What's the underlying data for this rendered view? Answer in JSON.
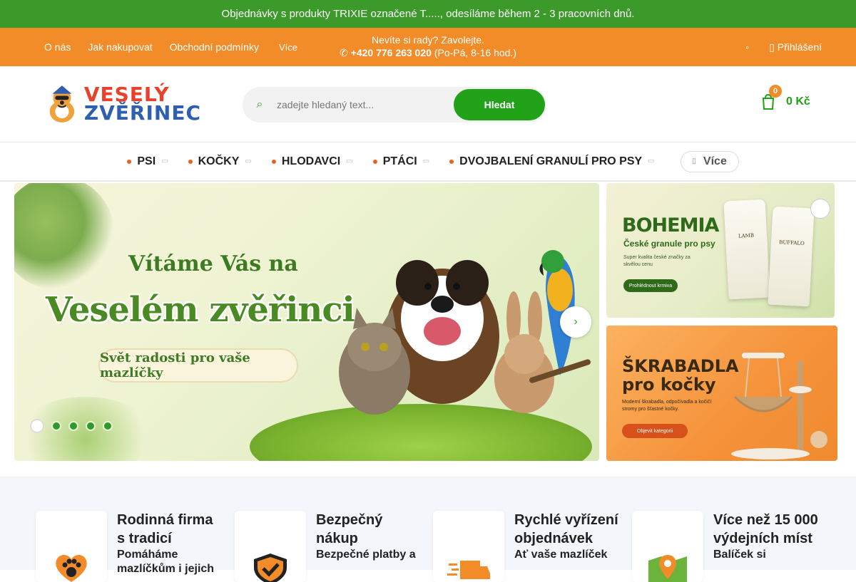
{
  "promo": {
    "text": "Objednávky s produkty TRIXIE označené T....., odesíláme během 2 - 3 pracovních dnů."
  },
  "topbar": {
    "links": [
      "O nás",
      "Jak nakupovat",
      "Obchodní podmínky"
    ],
    "more_label": "Více",
    "contact_line1": "Nevíte si rady? Zavolejte.",
    "phone": "+420 776 263 020",
    "hours": "(Po-Pá, 8-16 hod.)",
    "login_label": "Přihlášení"
  },
  "header": {
    "logo_line1": "VESELÝ",
    "logo_line2": "ZVĚŘINEC",
    "search_placeholder": "zadejte hledaný text...",
    "search_button": "Hledat",
    "cart_count": "0",
    "cart_total": "0 Kč"
  },
  "nav": {
    "items": [
      "PSI",
      "KOČKY",
      "HLODAVCI",
      "PTÁCI",
      "DVOJBALENÍ GRANULÍ PRO PSY"
    ],
    "more_label": "Více"
  },
  "hero": {
    "title_line1": "Vítáme Vás na",
    "title_line2": "Veselém zvěřinci",
    "subtitle": "Svět radosti pro vaše mazlíčky",
    "slide_count": 5,
    "active_slide": 1
  },
  "banner_bohemia": {
    "title": "BOHEMIA",
    "subtitle": "České granule pro psy",
    "desc": "Super kvalita české značky za skvělou cenu",
    "button": "Prohlédnout krmiva",
    "bag1_label": "LAMB",
    "bag2_label": "BUFFALO"
  },
  "banner_scratch": {
    "title_line1": "ŠKRABADLA",
    "title_line2": "pro kočky",
    "desc": "Moderní škrabadla, odpočívadla a kočičí stromy pro šťastné kočky.",
    "button": "Objevit kategorii"
  },
  "features": [
    {
      "title": "Rodinná firma s tradicí",
      "sub": "Pomáháme mazlíčkům i jejich"
    },
    {
      "title": "Bezpečný nákup",
      "sub": "Bezpečné platby a"
    },
    {
      "title": "Rychlé vyřízení objednávek",
      "sub": "Ať vaše mazlíček"
    },
    {
      "title": "Více než 15 000 výdejních míst",
      "sub": "Balíček si"
    }
  ],
  "colors": {
    "green": "#3b9a2a",
    "orange": "#f28c28",
    "button_green": "#22a219"
  }
}
